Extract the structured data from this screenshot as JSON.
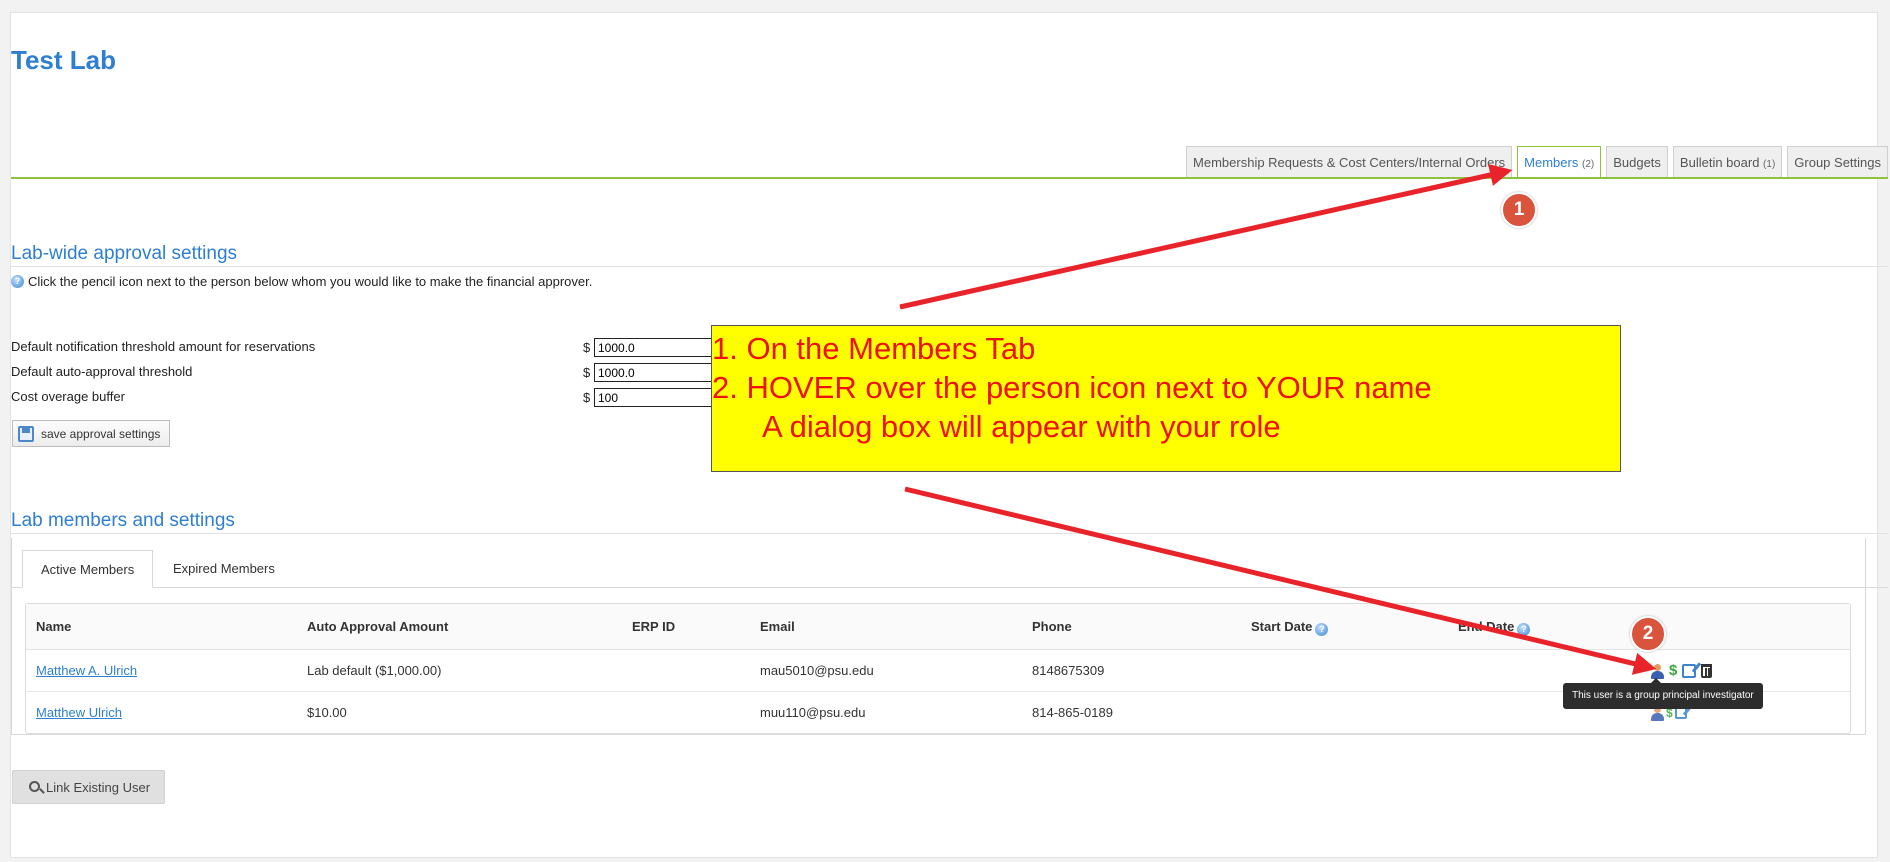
{
  "lab": {
    "title": "Test Lab"
  },
  "tabs": [
    {
      "label": "Membership Requests & Cost Centers/Internal Orders",
      "count": ""
    },
    {
      "label": "Members",
      "count": "(2)"
    },
    {
      "label": "Budgets",
      "count": ""
    },
    {
      "label": "Bulletin board",
      "count": "(1)"
    },
    {
      "label": "Group Settings",
      "count": ""
    }
  ],
  "approval": {
    "title": "Lab-wide approval settings",
    "help": "Click the pencil icon next to the person below whom you would like to make the financial approver.",
    "currency": "$",
    "rows": [
      {
        "label": "Default notification threshold amount for reservations",
        "value": "1000.0"
      },
      {
        "label": "Default auto-approval threshold",
        "value": "1000.0"
      },
      {
        "label": "Cost overage buffer",
        "value": "100"
      }
    ],
    "save_label": "save approval settings"
  },
  "members": {
    "title": "Lab members and settings",
    "tabs": [
      "Active Members",
      "Expired Members"
    ],
    "columns": [
      "Name",
      "Auto Approval Amount",
      "ERP ID",
      "Email",
      "Phone",
      "Start Date",
      "End Date"
    ],
    "rows": [
      {
        "name": "Matthew A. Ulrich",
        "auto": "Lab default ($1,000.00)",
        "erp": "",
        "email": "mau5010@psu.edu",
        "phone": "8148675309",
        "start": "",
        "end": ""
      },
      {
        "name": "Matthew Ulrich",
        "auto": "$10.00",
        "erp": "",
        "email": "muu110@psu.edu",
        "phone": "814-865-0189",
        "start": "",
        "end": ""
      }
    ],
    "tooltip": "This user is a group principal investigator",
    "link_label": "Link Existing User"
  },
  "annotation": {
    "lines": [
      "1. On the Members Tab",
      "2. HOVER over the person icon next to YOUR name",
      "A dialog box will appear with your role"
    ],
    "badges": [
      "1",
      "2"
    ]
  },
  "icons": {
    "help": "question-icon",
    "save": "floppy-icon",
    "role": "person-icon",
    "budget": "dollar-icon",
    "edit": "pencil-edit-icon",
    "delete": "trash-icon",
    "search": "search-icon"
  },
  "colors": {
    "brand_blue": "#2f7fd0",
    "tab_green": "#8cc33a",
    "callout_bg": "#ffff00",
    "callout_text": "#ee1111",
    "badge": "#d9533d",
    "arrow": "#e8232a"
  }
}
